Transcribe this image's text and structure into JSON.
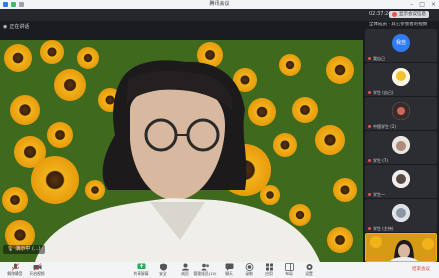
{
  "window": {
    "title": "腾讯会议"
  },
  "topbar": {
    "clock": "02:37:24",
    "user_chip": "显示会议信息"
  },
  "stage": {
    "label": "正在讲话",
    "speaker_name": "演示中 (...)"
  },
  "sidebar": {
    "header": "全体成员 · 其它参会者的视频",
    "tiles": [
      {
        "label": "我自己",
        "host_text": "我自"
      },
      {
        "label": "学生 (自己)"
      },
      {
        "label": "中国学生 (2)"
      },
      {
        "label": "学生 (7)"
      },
      {
        "label": "学生一"
      },
      {
        "label": "学生 (主持)"
      },
      {
        "label": ""
      }
    ]
  },
  "toolbar": {
    "left_tools": [
      {
        "label": "解除静音",
        "icon": "mic-icon"
      },
      {
        "label": "开启视频",
        "icon": "camera-icon"
      }
    ],
    "tools": [
      {
        "label": "共享屏幕",
        "icon": "share-screen-icon"
      },
      {
        "label": "安全",
        "icon": "shield-icon"
      },
      {
        "label": "成员",
        "icon": "members-icon"
      },
      {
        "label": "管理成员(10)",
        "icon": "manage-members-icon"
      },
      {
        "label": "聊天",
        "icon": "chat-icon"
      },
      {
        "label": "录制",
        "icon": "record-icon"
      },
      {
        "label": "应用",
        "icon": "apps-icon"
      },
      {
        "label": "布局",
        "icon": "layout-icon"
      },
      {
        "label": "设置",
        "icon": "gear-icon"
      }
    ],
    "leave": "结束会议"
  },
  "colors": {
    "accent": "#2f7cf6",
    "danger": "#e0443a",
    "toolbar_bg": "#f3f4f6"
  }
}
